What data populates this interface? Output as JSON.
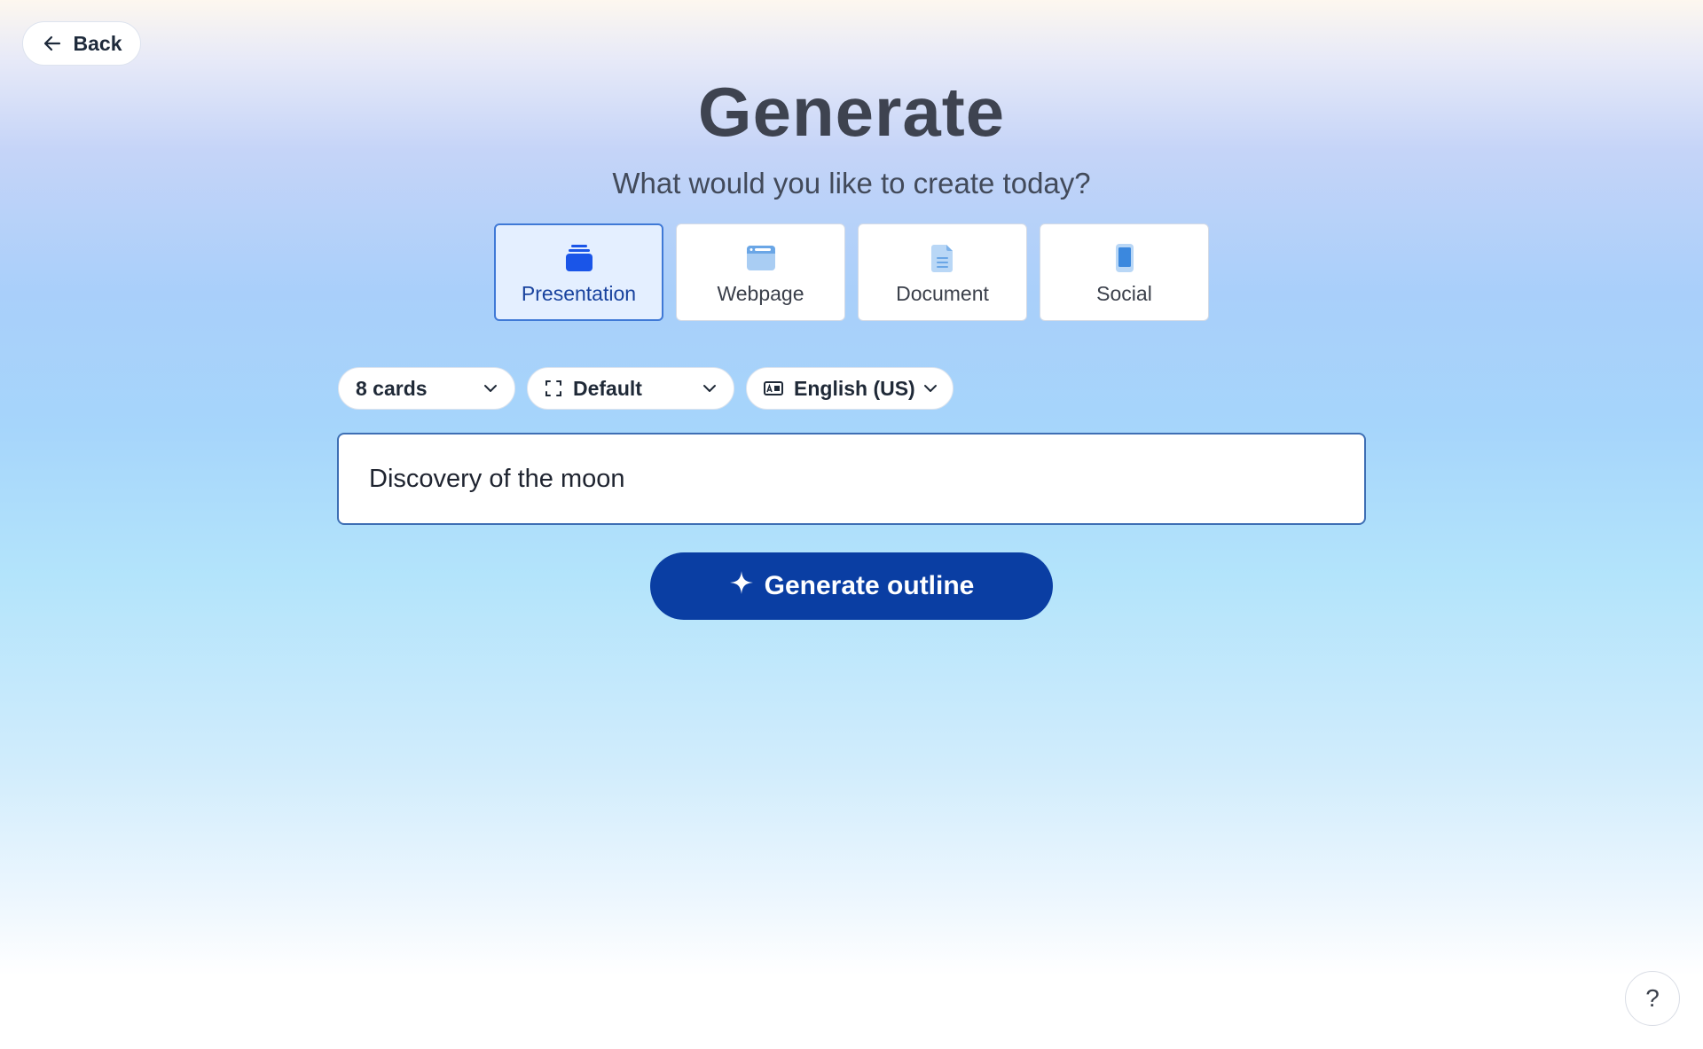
{
  "header": {
    "back_label": "Back",
    "title": "Generate",
    "subtitle": "What would you like to create today?"
  },
  "content_types": [
    {
      "label": "Presentation",
      "icon": "presentation-stack-icon",
      "selected": true
    },
    {
      "label": "Webpage",
      "icon": "browser-window-icon",
      "selected": false
    },
    {
      "label": "Document",
      "icon": "document-icon",
      "selected": false
    },
    {
      "label": "Social",
      "icon": "phone-icon",
      "selected": false
    }
  ],
  "options": {
    "cards": {
      "value": "8 cards",
      "icon": "chevron-down-icon"
    },
    "theme": {
      "value": "Default",
      "icon": "aspect-ratio-icon"
    },
    "language": {
      "value": "English (US)",
      "icon": "language-icon"
    }
  },
  "prompt": {
    "value": "Discovery of the moon"
  },
  "generate_button": {
    "label": "Generate outline",
    "icon": "sparkle-icon"
  },
  "help": {
    "label": "?"
  },
  "colors": {
    "accent": "#0a3ea3",
    "selected_card_bg": "#e4efff",
    "selected_card_border": "#3f79d6",
    "title_text": "#3e4350"
  }
}
